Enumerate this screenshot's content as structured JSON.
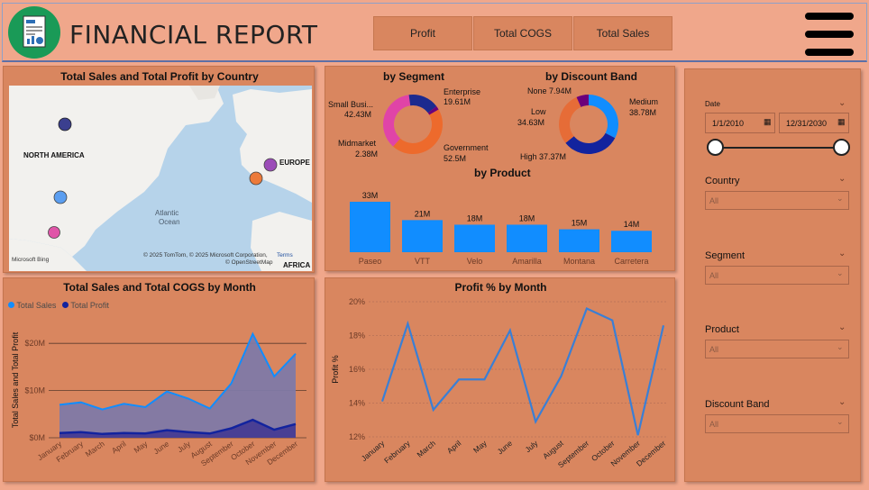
{
  "header": {
    "title": "FINANCIAL REPORT",
    "nav": [
      {
        "label": "Profit"
      },
      {
        "label": "Total COGS"
      },
      {
        "label": "Total Sales"
      }
    ]
  },
  "map_panel": {
    "title": "Total Sales and Total Profit by Country",
    "labels": {
      "north_america": "NORTH AMERICA",
      "europe": "EUROPE",
      "africa": "AFRICA",
      "atlantic": "Atlantic",
      "ocean": "Ocean"
    },
    "attribution": "© 2025 TomTom, © 2025 Microsoft Corporation,",
    "terms": "Terms",
    "osm": "© OpenStreetMap",
    "bing": "Microsoft Bing",
    "colors": {
      "land": "#f2f1ee",
      "water": "#b6d3ea"
    }
  },
  "segment_chart": {
    "title": "by Segment",
    "labels": [
      {
        "name": "Small Busi...",
        "value": "42.43M"
      },
      {
        "name": "Enterprise",
        "value": "19.61M"
      },
      {
        "name": "Midmarket",
        "value": "2.38M"
      },
      {
        "name": "Government",
        "value": "52.5M"
      }
    ]
  },
  "discount_chart": {
    "title": "by Discount Band",
    "labels": [
      {
        "name": "None",
        "value": "7.94M"
      },
      {
        "name": "Medium",
        "value": "38.78M"
      },
      {
        "name": "Low",
        "value": "34.63M"
      },
      {
        "name": "High",
        "value": "37.37M"
      }
    ]
  },
  "product_chart": {
    "title": "by Product"
  },
  "month_chart": {
    "title": "Total Sales and Total COGS by Month",
    "legend": [
      "Total Sales",
      "Total Profit"
    ],
    "ylabel": "Total Sales and Total Profit"
  },
  "profit_chart": {
    "title": "Profit % by Month",
    "ylabel": "Profit %"
  },
  "slicers": {
    "date_label": "Date",
    "date_from": "1/1/2010",
    "date_to": "12/31/2030",
    "items": [
      {
        "label": "Country",
        "value": "All"
      },
      {
        "label": "Segment",
        "value": "All"
      },
      {
        "label": "Product",
        "value": "All"
      },
      {
        "label": "Discount Band",
        "value": "All"
      }
    ]
  },
  "chart_data": [
    {
      "type": "pie",
      "title": "by Segment",
      "categories": [
        "Government",
        "Small Business",
        "Enterprise",
        "Midmarket"
      ],
      "values": [
        52.5,
        42.43,
        19.61,
        2.38
      ],
      "colors": [
        "#ed6a2c",
        "#e044a7",
        "#1c2a8f",
        "#6b007b"
      ]
    },
    {
      "type": "pie",
      "title": "by Discount Band",
      "categories": [
        "Medium",
        "High",
        "Low",
        "None"
      ],
      "values": [
        38.78,
        37.37,
        34.63,
        7.94
      ],
      "colors": [
        "#118dff",
        "#12239e",
        "#e66c37",
        "#6b007b"
      ]
    },
    {
      "type": "bar",
      "title": "by Product",
      "categories": [
        "Paseo",
        "VTT",
        "Velo",
        "Amarilla",
        "Montana",
        "Carretera"
      ],
      "values": [
        33,
        21,
        18,
        18,
        15,
        14
      ],
      "data_labels": [
        "33M",
        "21M",
        "18M",
        "18M",
        "15M",
        "14M"
      ],
      "color": "#118dff"
    },
    {
      "type": "area",
      "title": "Total Sales and Total COGS by Month",
      "ylabel": "Total Sales and Total Profit",
      "categories": [
        "January",
        "February",
        "March",
        "April",
        "May",
        "June",
        "July",
        "August",
        "September",
        "October",
        "November",
        "December"
      ],
      "yticks": [
        "$0M",
        "$10M",
        "$20M"
      ],
      "ylim": [
        0,
        25
      ],
      "series": [
        {
          "name": "Total Sales",
          "values": [
            7,
            7.5,
            6,
            7.2,
            6.5,
            9.8,
            8.3,
            6.2,
            11.5,
            22,
            13,
            17.8
          ],
          "color": "#118dff"
        },
        {
          "name": "Total Profit",
          "values": [
            1,
            1.2,
            0.8,
            1,
            0.9,
            1.6,
            1.2,
            0.9,
            2,
            3.8,
            1.7,
            2.9
          ],
          "color": "#12239e"
        }
      ]
    },
    {
      "type": "line",
      "title": "Profit % by Month",
      "ylabel": "Profit %",
      "categories": [
        "January",
        "February",
        "March",
        "April",
        "May",
        "June",
        "July",
        "August",
        "September",
        "October",
        "November",
        "December"
      ],
      "yticks": [
        "12%",
        "14%",
        "16%",
        "18%",
        "20%"
      ],
      "ylim": [
        12,
        20
      ],
      "series": [
        {
          "name": "Profit %",
          "values": [
            14.1,
            18.7,
            13.6,
            15.4,
            15.4,
            18.3,
            12.9,
            15.6,
            19.6,
            18.9,
            12.1,
            18.6
          ],
          "color": "#3a7fd5"
        }
      ]
    }
  ]
}
